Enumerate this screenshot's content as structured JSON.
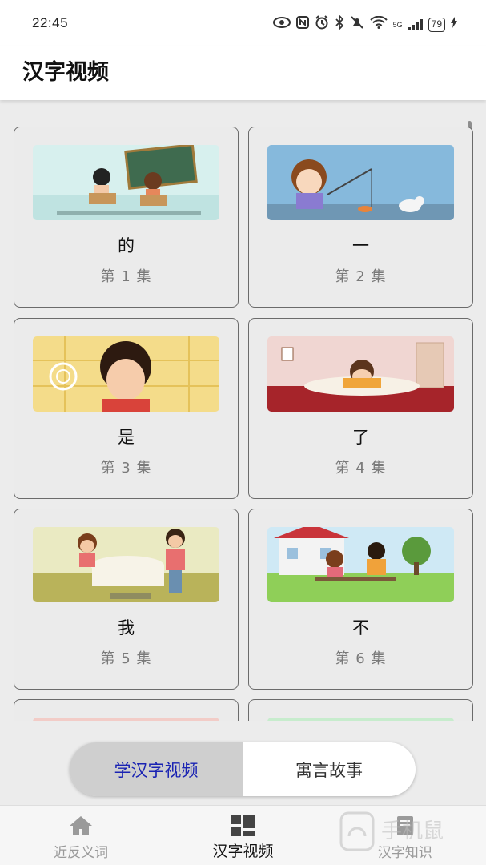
{
  "status_bar": {
    "time": "22:45",
    "network": "5G",
    "battery": "79",
    "icons": [
      "eye-icon",
      "nfc-icon",
      "alarm-icon",
      "bluetooth-icon",
      "mute-icon",
      "wifi-icon",
      "signal-icon",
      "battery-icon",
      "charging-icon"
    ]
  },
  "header": {
    "title": "汉字视频"
  },
  "videos": [
    {
      "char": "的",
      "episode": "第 1 集"
    },
    {
      "char": "一",
      "episode": "第 2 集"
    },
    {
      "char": "是",
      "episode": "第 3 集"
    },
    {
      "char": "了",
      "episode": "第 4 集"
    },
    {
      "char": "我",
      "episode": "第 5 集"
    },
    {
      "char": "不",
      "episode": "第 6 集"
    }
  ],
  "toggle": {
    "active_label": "学汉字视频",
    "inactive_label": "寓言故事"
  },
  "bottom_nav": [
    {
      "label": "近反义词",
      "icon": "home-icon"
    },
    {
      "label": "汉字视频",
      "icon": "grid-icon"
    },
    {
      "label": "汉字知识",
      "icon": "book-icon"
    }
  ],
  "watermark": {
    "text": "手机鼠"
  },
  "colors": {
    "toggle_active_text": "#1a23b3",
    "toggle_active_bg": "#cfcfcf",
    "background": "#ececec"
  }
}
